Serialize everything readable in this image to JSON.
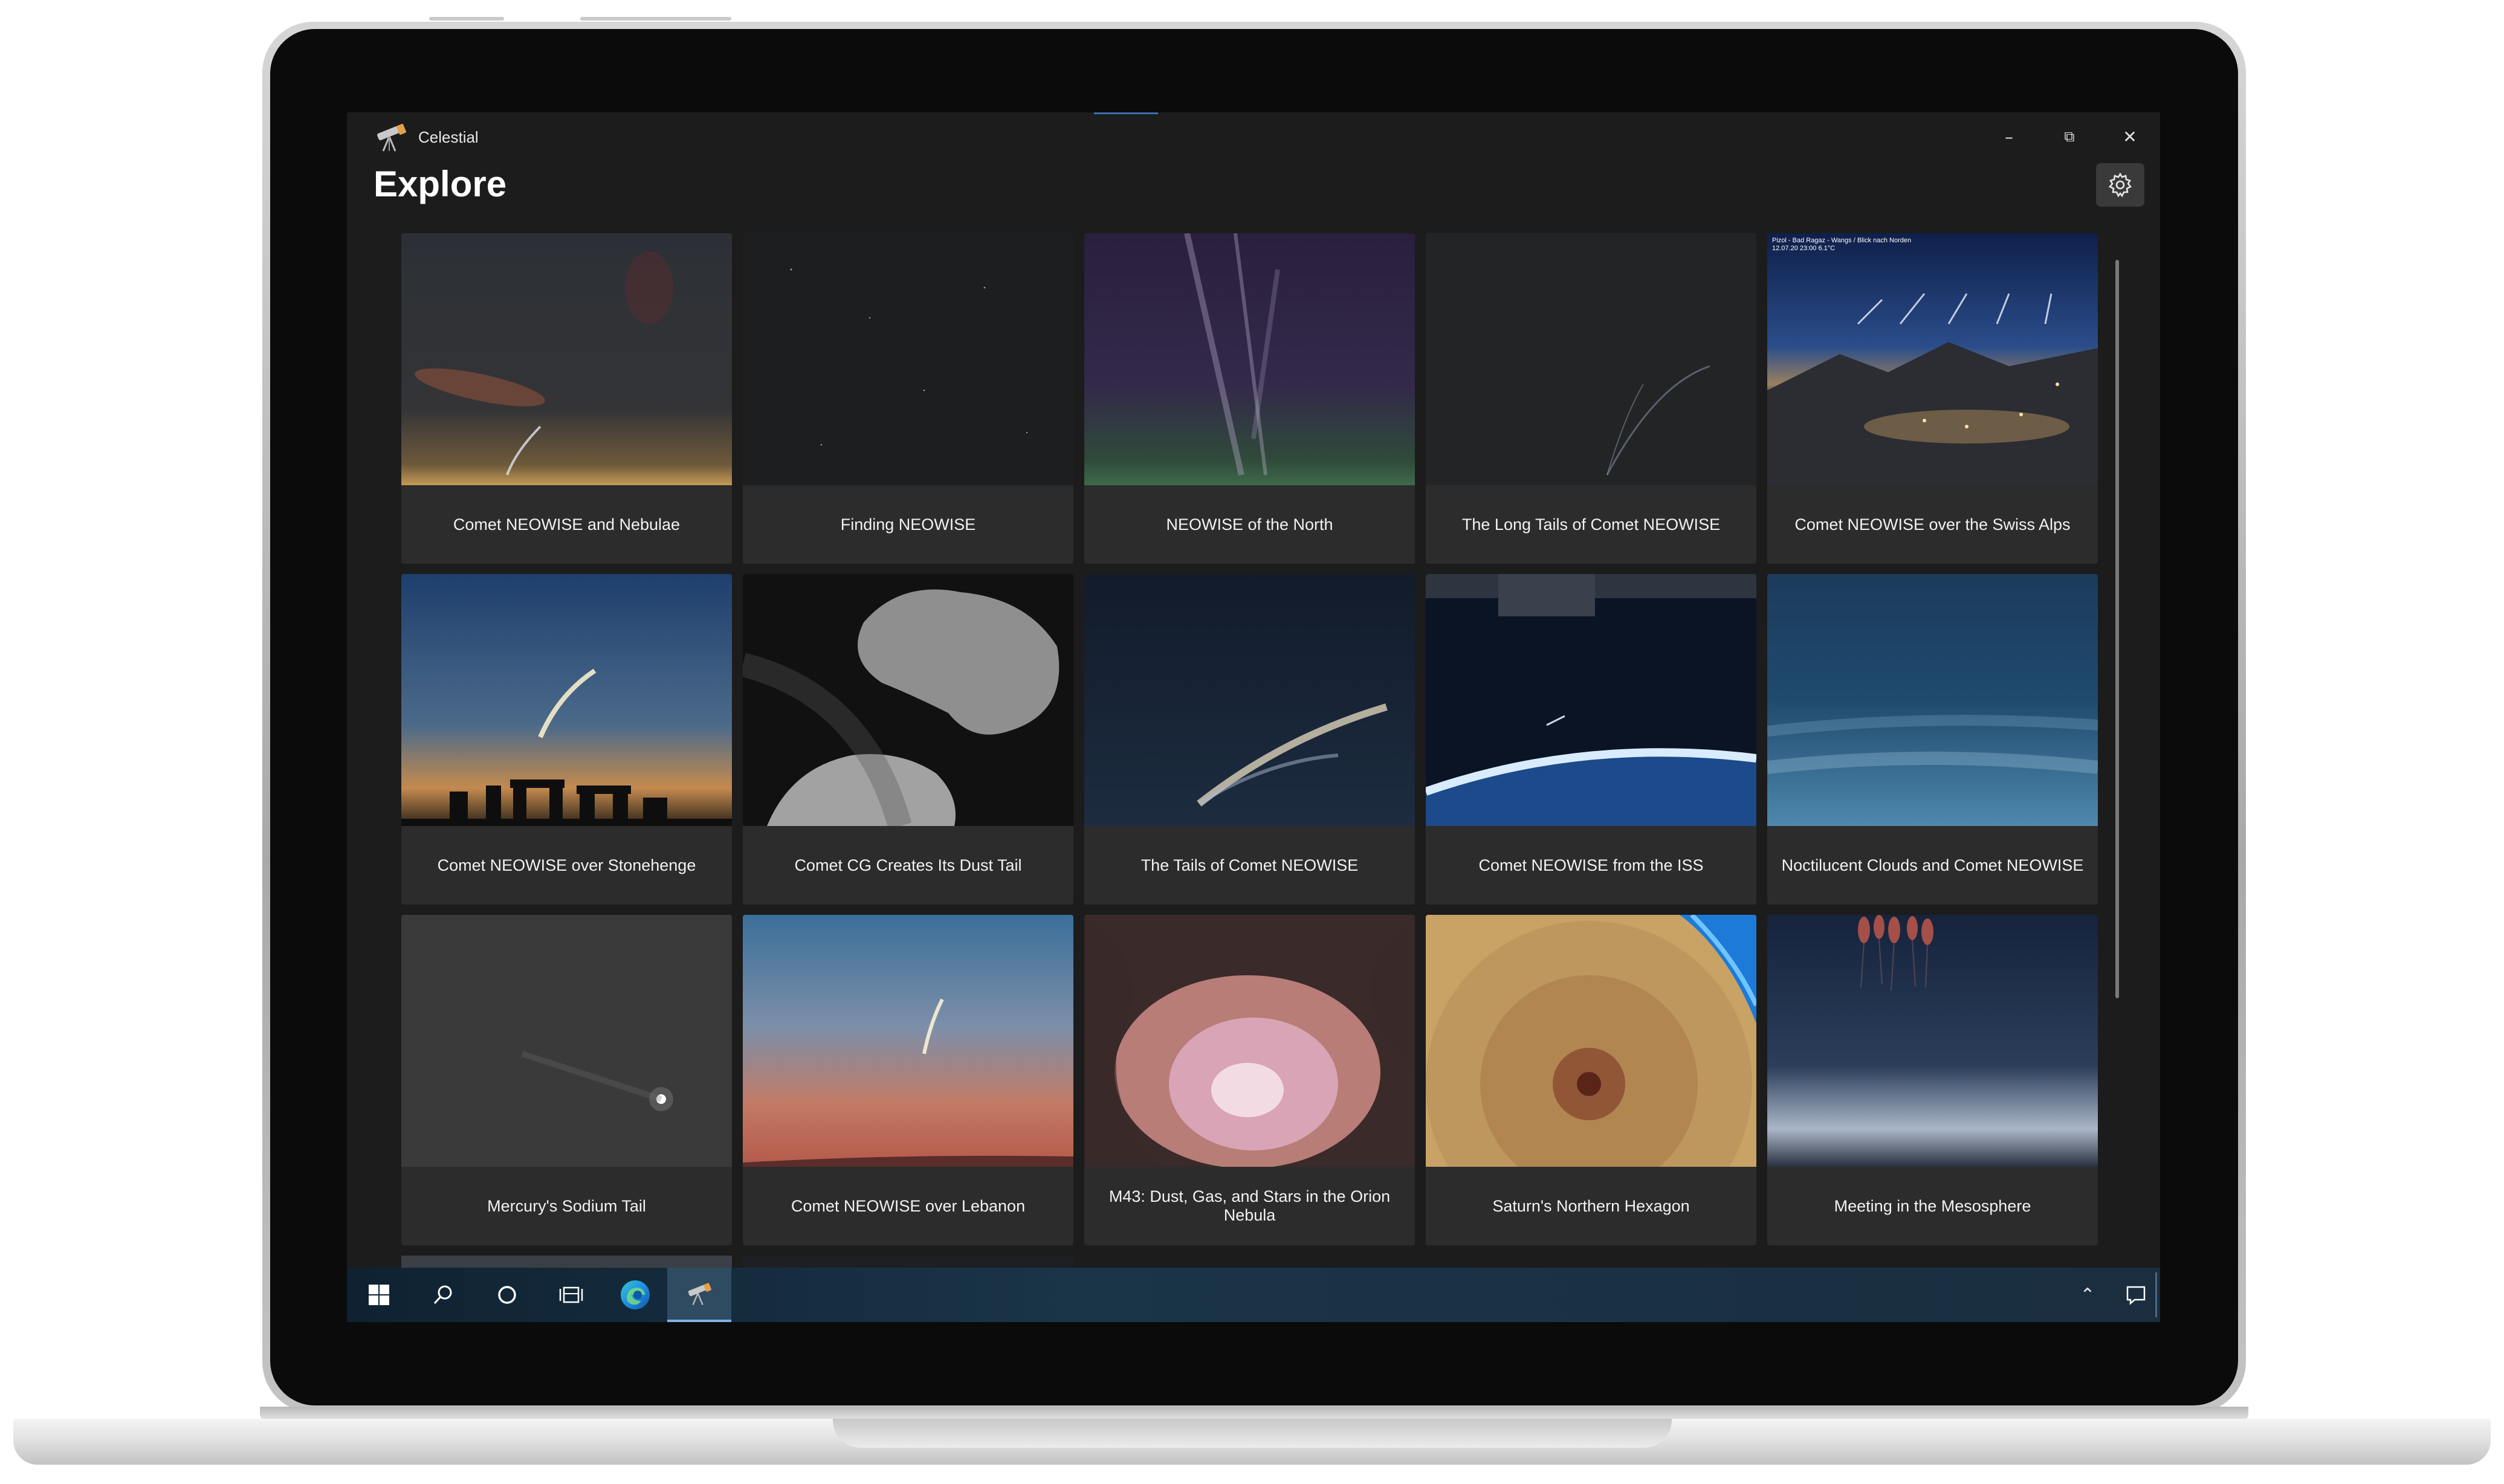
{
  "window": {
    "app_name": "Celestial",
    "minimize_glyph": "–",
    "restore_glyph": "⧉",
    "close_glyph": "✕"
  },
  "page": {
    "title": "Explore",
    "settings_icon": "gear-icon"
  },
  "gallery": {
    "items": [
      {
        "title": "Comet NEOWISE and Nebulae"
      },
      {
        "title": "Finding NEOWISE"
      },
      {
        "title": "NEOWISE of the North"
      },
      {
        "title": "The Long Tails of Comet NEOWISE"
      },
      {
        "title": "Comet NEOWISE over the Swiss Alps",
        "overlay_text_1": "Pizol - Bad Ragaz - Wangs / Blick nach Norden",
        "overlay_text_2": "12.07.20 23:00    6.1°C"
      },
      {
        "title": "Comet NEOWISE over Stonehenge"
      },
      {
        "title": "Comet CG Creates Its Dust Tail"
      },
      {
        "title": "The Tails of Comet NEOWISE"
      },
      {
        "title": "Comet NEOWISE from the ISS"
      },
      {
        "title": "Noctilucent Clouds and Comet NEOWISE"
      },
      {
        "title": "Mercury's Sodium Tail"
      },
      {
        "title": "Comet NEOWISE over Lebanon"
      },
      {
        "title": "M43: Dust, Gas, and Stars in the Orion Nebula"
      },
      {
        "title": "Saturn's Northern Hexagon"
      },
      {
        "title": "Meeting in the Mesosphere"
      }
    ],
    "selected_index": 7
  },
  "taskbar": {
    "items": [
      "windows-start-icon",
      "search-icon",
      "cortana-icon",
      "task-view-icon",
      "edge-browser-icon",
      "celestial-app-icon"
    ],
    "active": "celestial-app-icon",
    "tray": [
      "show-hidden-icons-chevron",
      "action-center-icon"
    ],
    "chevron_glyph": "⌃"
  },
  "colors": {
    "window_bg": "#1c1c1c",
    "card_caption_bg": "#2c2c2c",
    "accent": "#3a6fb0",
    "taskbar": "#1a3448"
  }
}
